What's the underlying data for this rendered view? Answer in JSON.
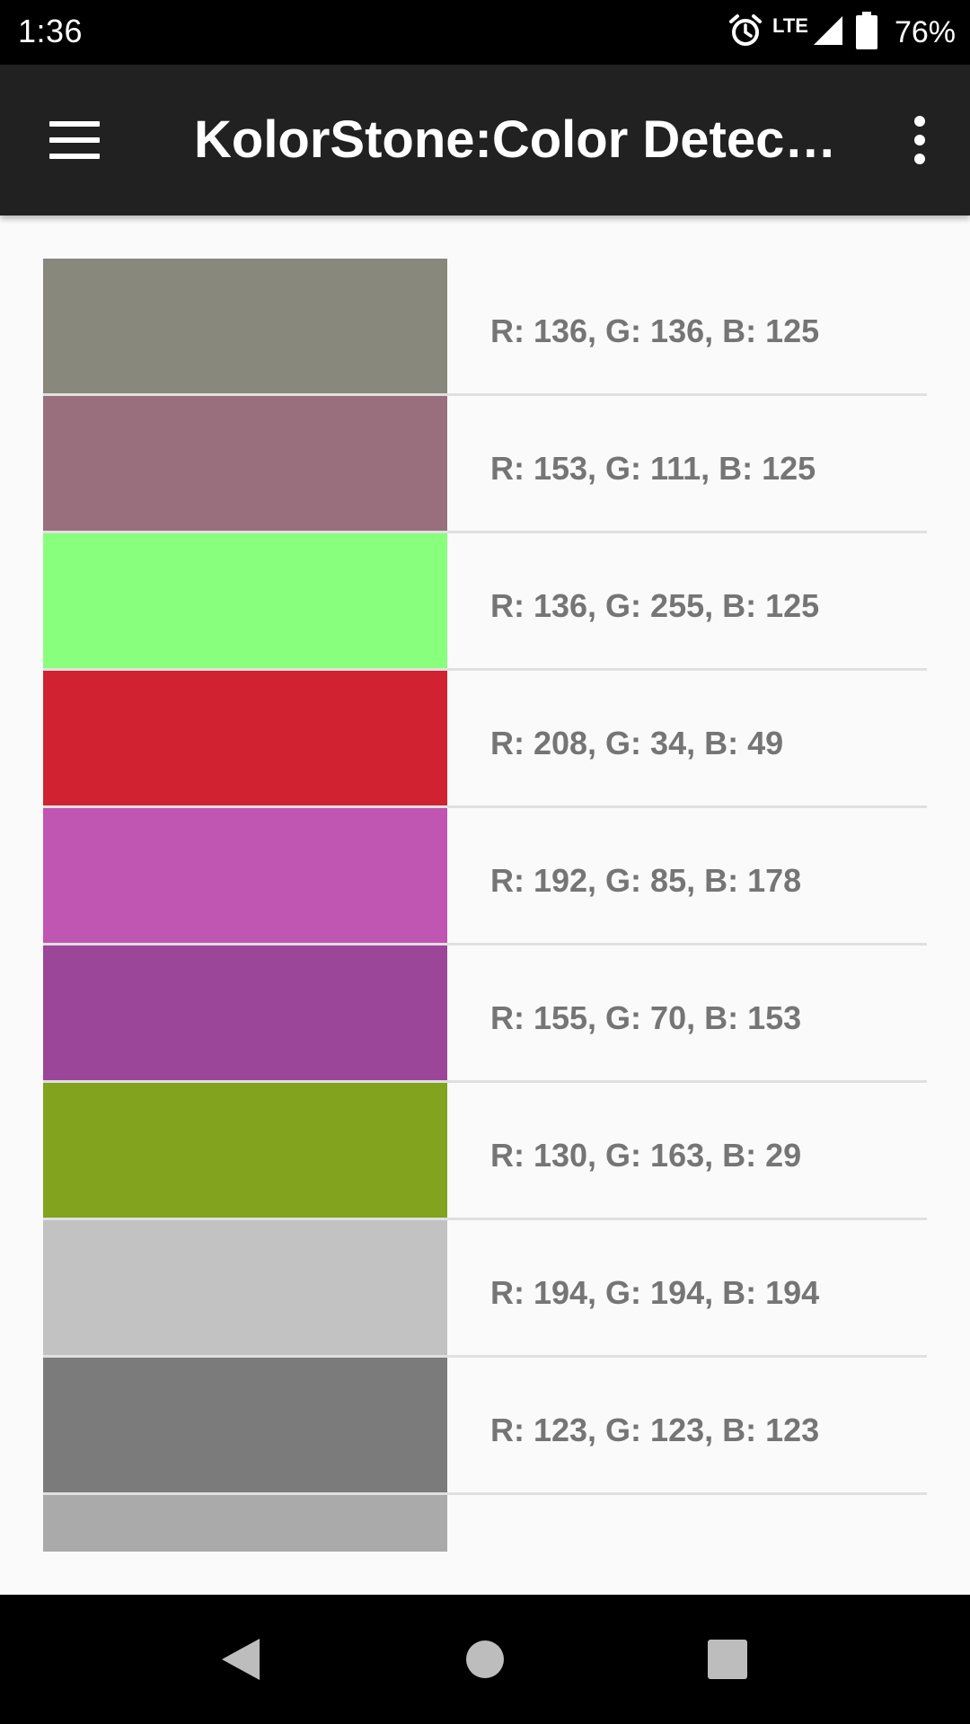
{
  "status_bar": {
    "time": "1:36",
    "network": "LTE",
    "battery": "76%"
  },
  "app_bar": {
    "title": "KolorStone:Color Detecti…"
  },
  "colors": [
    {
      "label": "R: 136, G: 136, B: 125",
      "hex": "#88887d"
    },
    {
      "label": "R: 153, G: 111, B: 125",
      "hex": "#996f7d"
    },
    {
      "label": "R: 136, G: 255, B: 125",
      "hex": "#88ff7d"
    },
    {
      "label": "R: 208, G: 34, B: 49",
      "hex": "#d02231"
    },
    {
      "label": "R: 192, G: 85, B: 178",
      "hex": "#c055b2"
    },
    {
      "label": "R: 155, G: 70, B: 153",
      "hex": "#9b4699"
    },
    {
      "label": "R: 130, G: 163, B: 29",
      "hex": "#82a31d"
    },
    {
      "label": "R: 194, G: 194, B: 194",
      "hex": "#c2c2c2"
    },
    {
      "label": "R: 123, G: 123, B: 123",
      "hex": "#7b7b7b"
    },
    {
      "label": "",
      "hex": "#aaaaaa"
    }
  ]
}
